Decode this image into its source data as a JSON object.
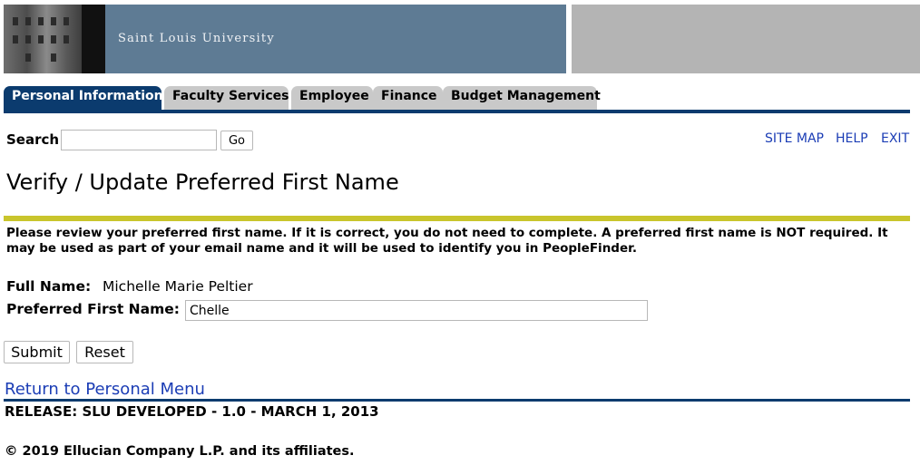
{
  "banner": {
    "university_name": "Saint Louis University",
    "colors": {
      "blue_panel": "#5e7b94",
      "gray_panel": "#b4b4b4"
    }
  },
  "tabs": [
    {
      "label": "Personal Information",
      "active": true
    },
    {
      "label": "Faculty Services",
      "active": false
    },
    {
      "label": "Employee",
      "active": false
    },
    {
      "label": "Finance",
      "active": false
    },
    {
      "label": "Budget Management",
      "active": false
    }
  ],
  "search": {
    "label": "Search",
    "value": "",
    "button_label": "Go"
  },
  "top_links": {
    "site_map": "SITE MAP",
    "help": "HELP",
    "exit": "EXIT"
  },
  "page": {
    "title": "Verify / Update Preferred First Name",
    "instructions": "Please review your preferred first name. If it is correct, you do not need to complete. A preferred first name is NOT required. It may be used as part of your email name and it will be used to identify you in PeopleFinder."
  },
  "form": {
    "full_name_label": "Full Name:",
    "full_name_value": "Michelle Marie Peltier",
    "preferred_label": "Preferred First Name:",
    "preferred_value": "Chelle",
    "submit_label": "Submit",
    "reset_label": "Reset"
  },
  "footer": {
    "return_link": "Return to Personal Menu",
    "release": "RELEASE: SLU DEVELOPED - 1.0 - MARCH 1, 2013",
    "copyright": "© 2019 Ellucian Company L.P. and its affiliates."
  },
  "colors": {
    "nav_blue": "#0b3b6e",
    "link_blue": "#1b3db5",
    "accent_yellow": "#c9c52c",
    "tab_gray": "#c9c9c9"
  }
}
